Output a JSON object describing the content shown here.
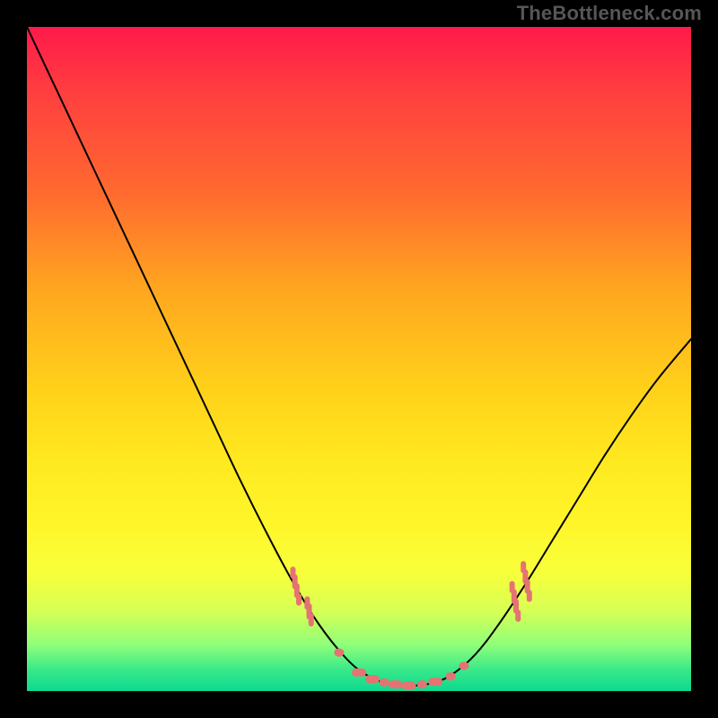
{
  "watermark_text": "TheBottleneck.com",
  "chart_data": {
    "type": "line",
    "title": "",
    "xlabel": "",
    "ylabel": "",
    "xlim": [
      0,
      1
    ],
    "ylim": [
      0,
      1
    ],
    "legend": false,
    "grid": false,
    "gradient_stops": [
      {
        "y": 1.0,
        "color": "#ff1a4a"
      },
      {
        "y": 0.9,
        "color": "#ff3f3f"
      },
      {
        "y": 0.75,
        "color": "#ff6a2f"
      },
      {
        "y": 0.6,
        "color": "#ffa81f"
      },
      {
        "y": 0.45,
        "color": "#ffd21a"
      },
      {
        "y": 0.35,
        "color": "#ffe820"
      },
      {
        "y": 0.25,
        "color": "#fff62a"
      },
      {
        "y": 0.18,
        "color": "#f8ff3a"
      },
      {
        "y": 0.12,
        "color": "#d6ff55"
      },
      {
        "y": 0.07,
        "color": "#8fff7a"
      },
      {
        "y": 0.03,
        "color": "#35e88a"
      },
      {
        "y": 0.0,
        "color": "#0ed890"
      }
    ],
    "series": [
      {
        "name": "bottleneck-curve",
        "color": "#000000",
        "width": 2,
        "points": [
          {
            "x": 0.0,
            "y": 1.0
          },
          {
            "x": 0.04,
            "y": 0.915
          },
          {
            "x": 0.08,
            "y": 0.83
          },
          {
            "x": 0.12,
            "y": 0.745
          },
          {
            "x": 0.16,
            "y": 0.66
          },
          {
            "x": 0.2,
            "y": 0.575
          },
          {
            "x": 0.24,
            "y": 0.49
          },
          {
            "x": 0.28,
            "y": 0.405
          },
          {
            "x": 0.32,
            "y": 0.32
          },
          {
            "x": 0.36,
            "y": 0.24
          },
          {
            "x": 0.4,
            "y": 0.165
          },
          {
            "x": 0.44,
            "y": 0.1
          },
          {
            "x": 0.48,
            "y": 0.05
          },
          {
            "x": 0.51,
            "y": 0.025
          },
          {
            "x": 0.54,
            "y": 0.012
          },
          {
            "x": 0.575,
            "y": 0.008
          },
          {
            "x": 0.61,
            "y": 0.012
          },
          {
            "x": 0.64,
            "y": 0.025
          },
          {
            "x": 0.675,
            "y": 0.055
          },
          {
            "x": 0.71,
            "y": 0.1
          },
          {
            "x": 0.75,
            "y": 0.16
          },
          {
            "x": 0.79,
            "y": 0.225
          },
          {
            "x": 0.83,
            "y": 0.29
          },
          {
            "x": 0.87,
            "y": 0.355
          },
          {
            "x": 0.91,
            "y": 0.415
          },
          {
            "x": 0.95,
            "y": 0.47
          },
          {
            "x": 1.0,
            "y": 0.53
          }
        ]
      },
      {
        "name": "highlight-markers",
        "color": "#e57373",
        "markers": [
          {
            "kind": "tick-cluster",
            "x": 0.405,
            "y_center": 0.158,
            "count": 4,
            "spread": 0.03
          },
          {
            "kind": "tick-cluster",
            "x": 0.425,
            "y_center": 0.12,
            "count": 3,
            "spread": 0.028
          },
          {
            "kind": "dot",
            "x": 0.47,
            "y": 0.058
          },
          {
            "kind": "dash",
            "x": 0.5,
            "y": 0.028
          },
          {
            "kind": "dash",
            "x": 0.52,
            "y": 0.018
          },
          {
            "kind": "dot",
            "x": 0.538,
            "y": 0.013
          },
          {
            "kind": "dash",
            "x": 0.555,
            "y": 0.01
          },
          {
            "kind": "dash",
            "x": 0.575,
            "y": 0.008
          },
          {
            "kind": "dot",
            "x": 0.595,
            "y": 0.01
          },
          {
            "kind": "dash",
            "x": 0.615,
            "y": 0.014
          },
          {
            "kind": "dot",
            "x": 0.638,
            "y": 0.022
          },
          {
            "kind": "dot",
            "x": 0.658,
            "y": 0.038
          },
          {
            "kind": "tick-cluster",
            "x": 0.735,
            "y_center": 0.135,
            "count": 4,
            "spread": 0.032
          },
          {
            "kind": "tick-cluster",
            "x": 0.752,
            "y_center": 0.165,
            "count": 4,
            "spread": 0.032
          }
        ]
      }
    ]
  }
}
